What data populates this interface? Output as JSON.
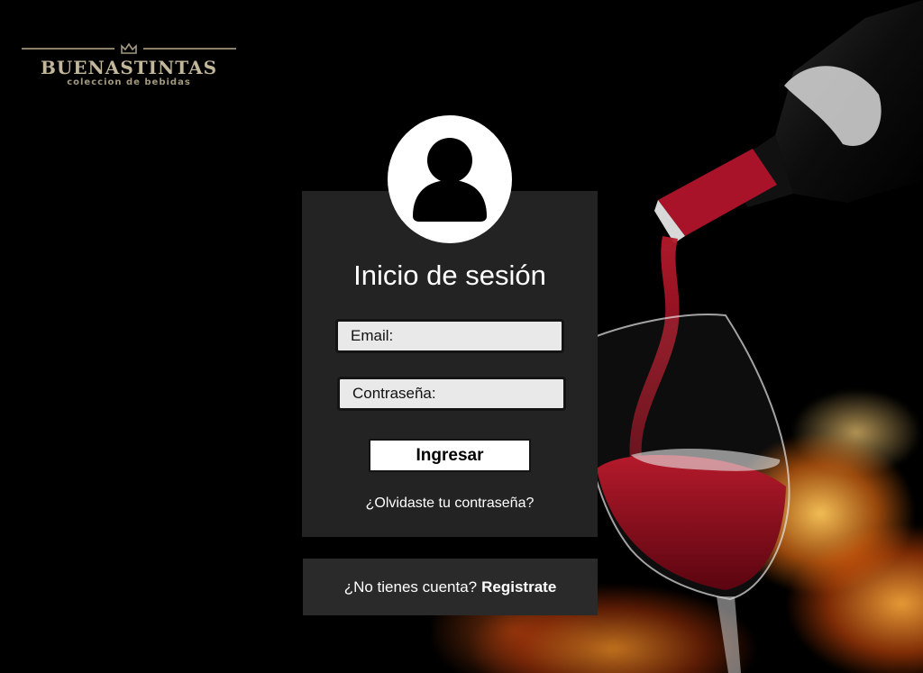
{
  "brand": {
    "name": "BUENASTINTAS",
    "tagline": "coleccion de bebidas"
  },
  "login": {
    "title": "Inicio de sesión",
    "email_placeholder": "Email:",
    "password_placeholder": "Contraseña:",
    "submit_label": "Ingresar",
    "forgot_label": "¿Olvidaste tu contraseña?"
  },
  "register": {
    "prompt": "¿No tienes cuenta?",
    "link_label": "Registrate"
  },
  "colors": {
    "background": "#000000",
    "card": "#232323",
    "register_card": "#2a2a2a",
    "input_bg": "#e9e9e9",
    "logo_gold": "#c2b69b",
    "wine_red": "#8c0d1c"
  },
  "icons": {
    "avatar": "user-silhouette-icon",
    "logo_ornament": "crown-icon"
  }
}
